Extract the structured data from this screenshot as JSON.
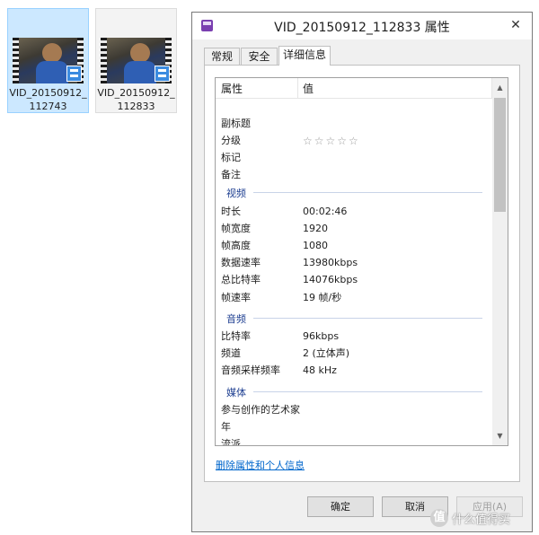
{
  "files": [
    {
      "name_line1": "VID_20150912_",
      "name_line2": "112743"
    },
    {
      "name_line1": "VID_20150912_",
      "name_line2": "112833"
    }
  ],
  "dialog": {
    "title": "VID_20150912_112833 属性",
    "close_glyph": "✕",
    "tabs": [
      "常规",
      "安全",
      "详细信息"
    ],
    "columns": {
      "property": "属性",
      "value": "值"
    },
    "rows_top": [
      {
        "key": "副标题",
        "value": ""
      },
      {
        "key": "分级",
        "value": ""
      },
      {
        "key": "标记",
        "value": ""
      },
      {
        "key": "备注",
        "value": ""
      }
    ],
    "stars": "☆☆☆☆☆",
    "video_section": "视频",
    "video_rows": [
      {
        "key": "时长",
        "value": "00:02:46"
      },
      {
        "key": "帧宽度",
        "value": "1920"
      },
      {
        "key": "帧高度",
        "value": "1080"
      },
      {
        "key": "数据速率",
        "value": "13980kbps"
      },
      {
        "key": "总比特率",
        "value": "14076kbps"
      },
      {
        "key": "帧速率",
        "value": "19 帧/秒"
      }
    ],
    "audio_section": "音频",
    "audio_rows": [
      {
        "key": "比特率",
        "value": "96kbps"
      },
      {
        "key": "频道",
        "value": "2 (立体声)"
      },
      {
        "key": "音频采样频率",
        "value": "48 kHz"
      }
    ],
    "media_section": "媒体",
    "media_rows": [
      {
        "key": "参与创作的艺术家",
        "value": ""
      },
      {
        "key": "年",
        "value": ""
      },
      {
        "key": "流派",
        "value": ""
      }
    ],
    "remove_link": "删除属性和个人信息",
    "buttons": {
      "ok": "确定",
      "cancel": "取消",
      "apply": "应用(A)"
    }
  },
  "watermark": {
    "logo": "值",
    "text": "什么值得买"
  }
}
